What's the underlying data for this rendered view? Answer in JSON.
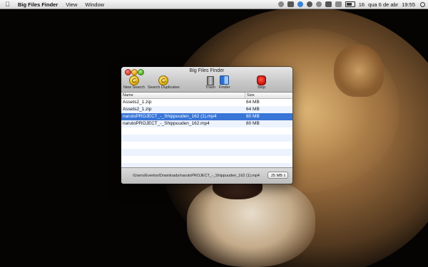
{
  "menubar": {
    "app_name": "Big Files Finder",
    "menus": [
      "View",
      "Window"
    ],
    "status": {
      "time_short": "16",
      "date": "qua 6 de abr",
      "clock": "19:55"
    }
  },
  "window": {
    "title": "Big Files Finder",
    "toolbar": {
      "new_search": "New Search",
      "search_duplicates": "Search Duplicates",
      "trash": "Trash",
      "finder": "Finder",
      "stop": "Stop"
    },
    "table": {
      "columns": {
        "name": "Name",
        "size": "Size"
      },
      "rows": [
        {
          "name": "Assets2_1.zip",
          "size": "64 MB"
        },
        {
          "name": "Assets2_1.zip",
          "size": "64 MB"
        },
        {
          "name": "narutoPROJECT_-_Shippuuden_162 (1).mp4",
          "size": "80 MB"
        },
        {
          "name": "narutoPROJECT_-_Shippuuden_162.mp4",
          "size": "80 MB"
        }
      ],
      "selected_index": 2
    },
    "footer": {
      "path": "/Users/Everton/Downloads/narutoPROJECT_-_Shippuuden_162 (1).mp4",
      "min_size": "25 MB"
    }
  },
  "colors": {
    "selection": "#3875d7",
    "alt_row": "#edf3fe"
  }
}
